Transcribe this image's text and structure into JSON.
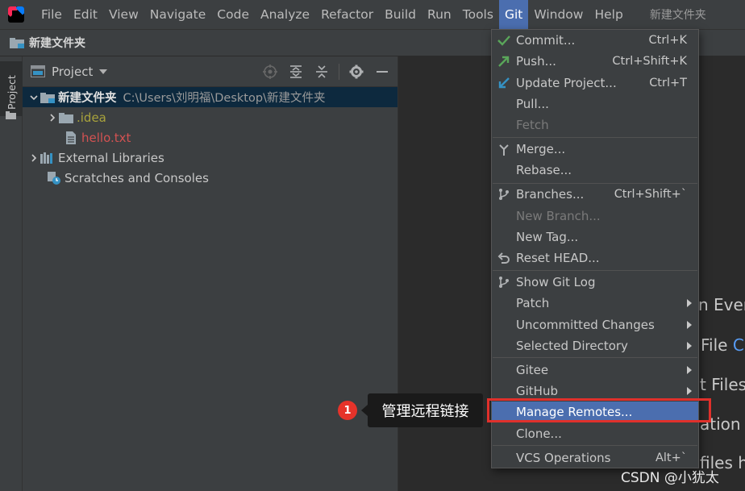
{
  "menubar": {
    "items": [
      "File",
      "Edit",
      "View",
      "Navigate",
      "Code",
      "Analyze",
      "Refactor",
      "Build",
      "Run",
      "Tools",
      "Git",
      "Window",
      "Help"
    ],
    "window_title": "新建文件夹"
  },
  "navbar": {
    "crumb": "新建文件夹"
  },
  "strip": {
    "tab_label": "Project"
  },
  "project": {
    "title": "Project",
    "root_name": "新建文件夹",
    "root_path": "C:\\Users\\刘明福\\Desktop\\新建文件夹",
    "idea": ".idea",
    "hello": "hello.txt",
    "ext_libs": "External Libraries",
    "scratches": "Scratches and Consoles"
  },
  "editor": {
    "hint1": "n Every",
    "hint2": "File",
    "hint2_key": "C",
    "hint3": "t Files",
    "hint4": "ation E",
    "hint5": "files he"
  },
  "git_menu": {
    "commit": "Commit...",
    "commit_sc": "Ctrl+K",
    "push": "Push...",
    "push_sc": "Ctrl+Shift+K",
    "update": "Update Project...",
    "update_sc": "Ctrl+T",
    "pull": "Pull...",
    "fetch": "Fetch",
    "merge": "Merge...",
    "rebase": "Rebase...",
    "branches": "Branches...",
    "branches_sc": "Ctrl+Shift+`",
    "new_branch": "New Branch...",
    "new_tag": "New Tag...",
    "reset_head": "Reset HEAD...",
    "show_log": "Show Git Log",
    "patch": "Patch",
    "uncommitted": "Uncommitted Changes",
    "selected_dir": "Selected Directory",
    "gitee": "Gitee",
    "github": "GitHub",
    "manage_remotes": "Manage Remotes...",
    "clone": "Clone...",
    "vcs_ops": "VCS Operations",
    "vcs_ops_sc": "Alt+`"
  },
  "annotation": {
    "badge": "1",
    "callout": "管理远程链接"
  },
  "watermark": "CSDN @小犹太",
  "colors": {
    "accent": "#4b6eaf",
    "red_box": "#e0302b",
    "badge": "#e6332a"
  }
}
